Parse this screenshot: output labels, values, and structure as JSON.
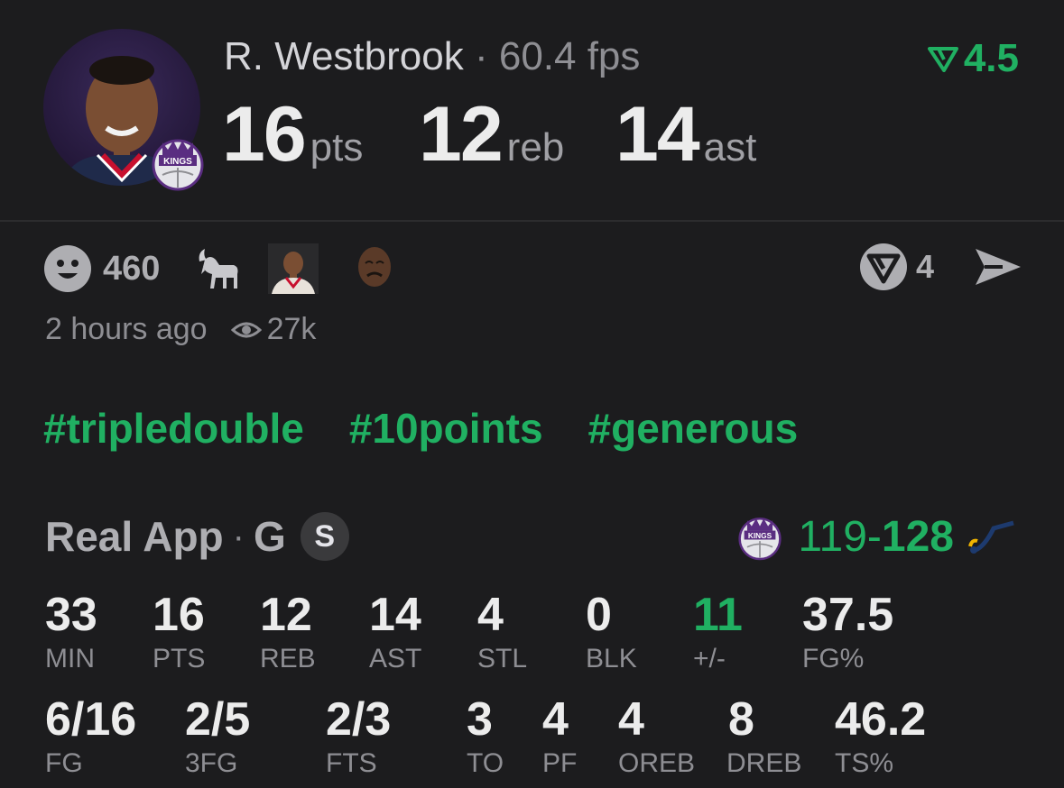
{
  "player": {
    "name": "R. Westbrook",
    "separator": "·",
    "fps": "60.4 fps",
    "team_badge_text": "SACRAMENTO KINGS"
  },
  "headline_stats": [
    {
      "value": "16",
      "unit": "pts"
    },
    {
      "value": "12",
      "unit": "reb"
    },
    {
      "value": "14",
      "unit": "ast"
    }
  ],
  "rating": {
    "value": "4.5",
    "color": "#20b062"
  },
  "reactions": {
    "count": "460",
    "icons": [
      "smiley-icon",
      "goat-icon",
      "player-face-icon",
      "crying-face-icon"
    ]
  },
  "comments": {
    "count": "4"
  },
  "meta": {
    "time": "2 hours ago",
    "views": "27k"
  },
  "hashtags": [
    "#tripledouble",
    "#10points",
    "#generous"
  ],
  "game": {
    "source": "Real App",
    "separator": "·",
    "position": "G",
    "badge": "S",
    "team_score": "119",
    "dash": "-",
    "opp_score": "128"
  },
  "stats_row1": [
    {
      "value": "33",
      "label": "MIN"
    },
    {
      "value": "16",
      "label": "PTS"
    },
    {
      "value": "12",
      "label": "REB"
    },
    {
      "value": "14",
      "label": "AST"
    },
    {
      "value": "4",
      "label": "STL"
    },
    {
      "value": "0",
      "label": "BLK"
    },
    {
      "value": "11",
      "label": "+/-",
      "highlight": true
    },
    {
      "value": "37.5",
      "label": "FG%"
    }
  ],
  "stats_row2": [
    {
      "value": "6/16",
      "label": "FG"
    },
    {
      "value": "2/5",
      "label": "3FG"
    },
    {
      "value": "2/3",
      "label": "FTS"
    },
    {
      "value": "3",
      "label": "TO"
    },
    {
      "value": "4",
      "label": "PF"
    },
    {
      "value": "4",
      "label": "OREB"
    },
    {
      "value": "8",
      "label": "DREB"
    },
    {
      "value": "46.2",
      "label": "TS%"
    }
  ],
  "colors": {
    "accent": "#20b062",
    "background": "#1c1c1e",
    "kings_purple": "#5a2d81"
  }
}
